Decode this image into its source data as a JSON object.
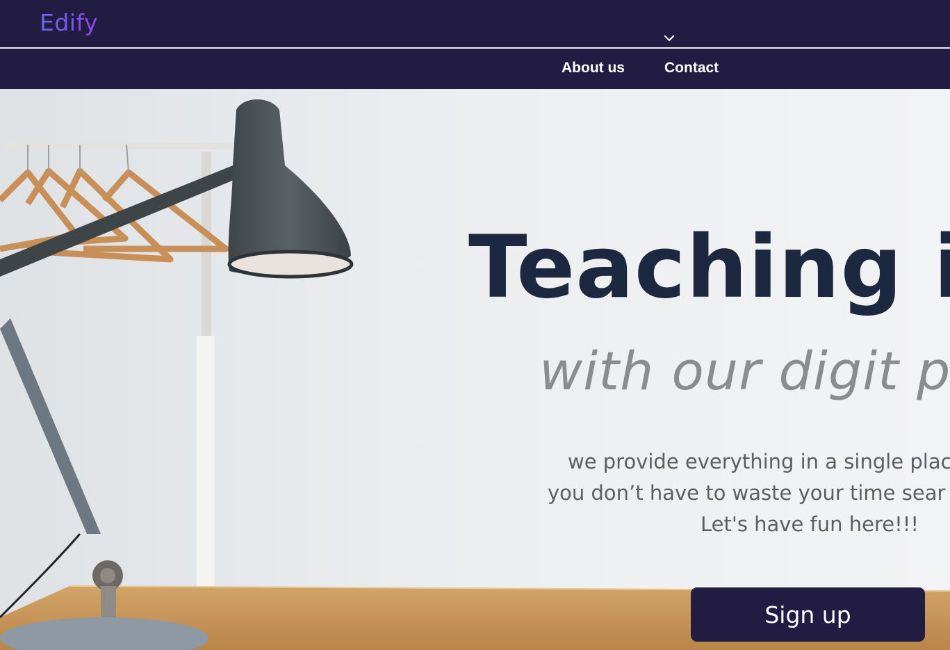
{
  "brand": {
    "logo_text": "Edify"
  },
  "header": {
    "dropdown_icon": "chevron-down-icon",
    "nav": [
      {
        "label": "About us"
      },
      {
        "label": "Contact"
      }
    ]
  },
  "hero": {
    "headline": "Teaching is",
    "subheadline": "with our digit pla",
    "paragraph_lines": [
      "we provide everything in a single plac",
      "you don’t have to waste your time sear",
      "Let's have fun here!!!"
    ],
    "cta_label": "Sign up",
    "background_image": "desk-lamp-with-clothes-rack-photo"
  },
  "colors": {
    "nav_background": "#221c42",
    "headline": "#1c2840",
    "subheadline": "#8a8c90",
    "paragraph": "#5c5e62",
    "cta_background": "#221c42",
    "logo_gradient_start": "#6e63f0",
    "logo_gradient_end": "#9440e8"
  }
}
